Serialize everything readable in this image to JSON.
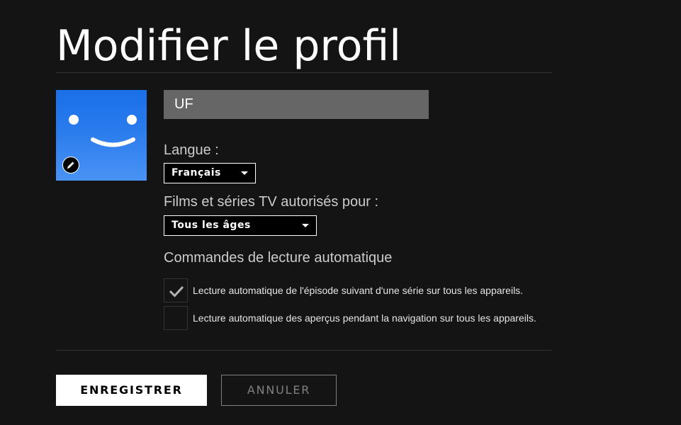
{
  "page": {
    "title": "Modifier le profil"
  },
  "profile": {
    "avatar_icon": "smiley-face-icon",
    "edit_icon": "pencil-icon",
    "name_value": "UF"
  },
  "language": {
    "label": "Langue :",
    "selected": "Français"
  },
  "maturity": {
    "label": "Films et séries TV autorisés pour :",
    "selected": "Tous les âges"
  },
  "autoplay": {
    "heading": "Commandes de lecture automatique",
    "options": [
      {
        "label": "Lecture automatique de l'épisode suivant d'une série sur tous les appareils.",
        "checked": true
      },
      {
        "label": "Lecture automatique des aperçus pendant la navigation sur tous les appareils.",
        "checked": false
      }
    ]
  },
  "actions": {
    "save_label": "ENREGISTRER",
    "cancel_label": "ANNULER"
  },
  "colors": {
    "background": "#141414",
    "avatar_blue": "#2a7bed",
    "input_gray": "#666666",
    "muted": "#808080"
  }
}
